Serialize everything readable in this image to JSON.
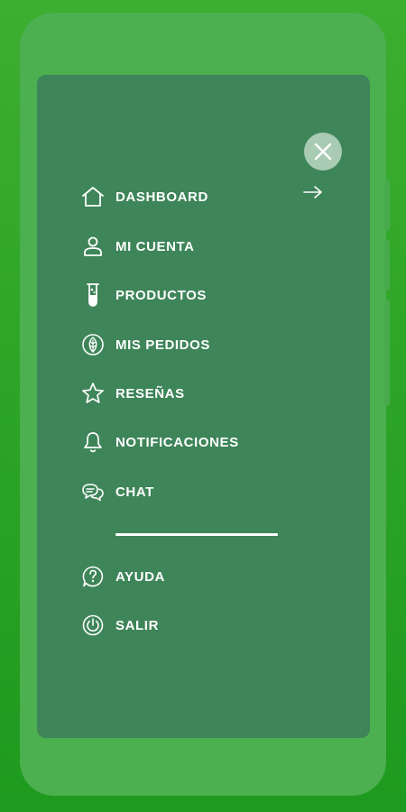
{
  "menu": {
    "items": [
      {
        "label": "DASHBOARD",
        "icon": "home-icon"
      },
      {
        "label": "MI CUENTA",
        "icon": "user-icon"
      },
      {
        "label": "PRODUCTOS",
        "icon": "test-tube-icon"
      },
      {
        "label": "MIS PEDIDOS",
        "icon": "leaf-badge-icon"
      },
      {
        "label": "RESEÑAS",
        "icon": "star-icon"
      },
      {
        "label": "NOTIFICACIONES",
        "icon": "bell-icon"
      },
      {
        "label": "CHAT",
        "icon": "chat-bubbles-icon"
      }
    ],
    "secondary": [
      {
        "label": "AYUDA",
        "icon": "help-icon"
      },
      {
        "label": "SALIR",
        "icon": "power-icon"
      }
    ]
  },
  "colors": {
    "background": "#2aa52a",
    "phone_body": "#4caf50",
    "drawer": "#3e8559",
    "close_button": "#a9cbb3",
    "text": "#ffffff"
  }
}
